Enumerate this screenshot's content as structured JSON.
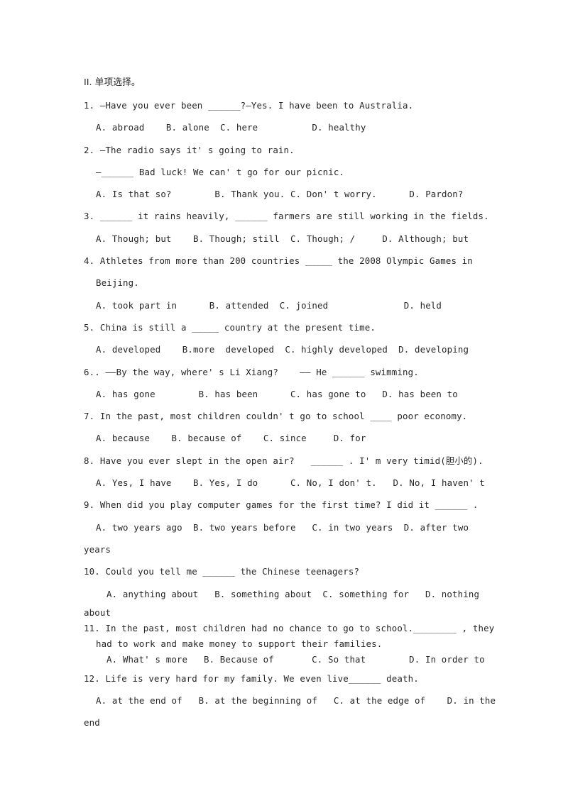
{
  "document": {
    "section_heading": "II. 单项选择。",
    "questions": [
      {
        "number": "1.",
        "stem": "1. —Have you ever been ______?—Yes. I have been to Australia.",
        "options": "A. abroad    B. alone  C. here          D. healthy"
      },
      {
        "number": "2.",
        "stem": "2. —The radio says it' s going to rain.",
        "stem_line2": "—______ Bad luck! We can' t go for our picnic.",
        "options": "A. Is that so?        B. Thank you. C. Don' t worry.      D. Pardon?"
      },
      {
        "number": "3.",
        "stem": "3. ______ it rains heavily, ______ farmers are still working in the fields.",
        "options": "A. Though; but    B. Though; still  C. Though; /     D. Although; but"
      },
      {
        "number": "4.",
        "stem": "4. Athletes from more than 200 countries _____ the 2008 Olympic Games in",
        "stem_line2": "Beijing.",
        "options": "A. took part in      B. attended  C. joined              D. held"
      },
      {
        "number": "5.",
        "stem": "5. China is still a _____ country at the present time.",
        "options": "A. developed    B.more  developed  C. highly developed  D. developing"
      },
      {
        "number": "6.",
        "stem": "6.. ——By the way, where' s Li Xiang?    —— He ______ swimming.",
        "options": "A. has gone        B. has been      C. has gone to   D. has been to"
      },
      {
        "number": "7.",
        "stem": "7. In the past, most children couldn' t go to school ____ poor economy.",
        "options": "A. because    B. because of    C. since     D. for"
      },
      {
        "number": "8.",
        "stem": "8. Have you ever slept in the open air?   ______ . I' m very timid(胆小的).",
        "options": "A. Yes, I have    B. Yes, I do      C. No, I don' t.   D. No, I haven' t"
      },
      {
        "number": "9.",
        "stem": "9. When did you play computer games for the first time? I did it ______ .",
        "options": "A. two years ago  B. two years before   C. in two years  D. after two",
        "options_wrap": "years"
      },
      {
        "number": "10.",
        "stem": "10. Could you tell me ______ the Chinese teenagers?",
        "options": "A. anything about   B. something about  C. something for   D. nothing",
        "options_wrap": "about"
      },
      {
        "number": "11.",
        "stem": "11. In the past, most children had no chance to go to school.________ , they",
        "stem_line2": "had to work and make money to support their families.",
        "options": "A. What' s more   B. Because of       C. So that        D. In order to"
      },
      {
        "number": "12.",
        "stem": "12. Life is very hard for my family. We even live______ death.",
        "options": "A. at the end of   B. at the beginning of   C. at the edge of    D. in the",
        "options_wrap": "end"
      }
    ]
  }
}
